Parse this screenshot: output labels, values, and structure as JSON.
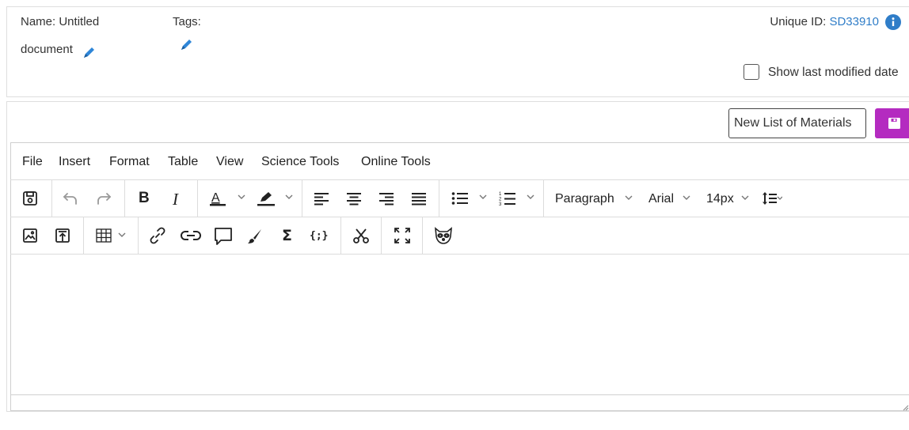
{
  "document": {
    "name_label": "Name: Untitled",
    "name_cont": "document",
    "tags_label": "Tags:",
    "unique_id_label": "Unique ID:",
    "unique_id_value": "SD33910",
    "show_last_modified_label": "Show last modified date",
    "show_last_modified_checked": false
  },
  "actions": {
    "new_list_label": "New List of Materials",
    "save_icon": "floppy-icon",
    "accent_color": "#b42bc0",
    "link_color": "#2f7dc8"
  },
  "menubar": [
    "File",
    "Insert",
    "Format",
    "Table",
    "View",
    "Science Tools",
    "Online Tools"
  ],
  "toolbar": {
    "block_format": "Paragraph",
    "font_family": "Arial",
    "font_size": "14px",
    "row1_icons": [
      "save-icon",
      "undo-icon",
      "redo-icon",
      "bold-icon",
      "italic-icon",
      "text-color-icon",
      "highlight-icon",
      "align-left-icon",
      "align-center-icon",
      "align-right-icon",
      "justify-icon",
      "bullet-list-icon",
      "numbered-list-icon",
      "line-height-icon"
    ],
    "row2_icons": [
      "image-icon",
      "upload-icon",
      "table-icon",
      "link-icon",
      "chain-link-icon",
      "comment-icon",
      "brush-icon",
      "sigma-icon",
      "code-icon",
      "scissors-icon",
      "fullscreen-icon",
      "raccoon-icon"
    ]
  }
}
